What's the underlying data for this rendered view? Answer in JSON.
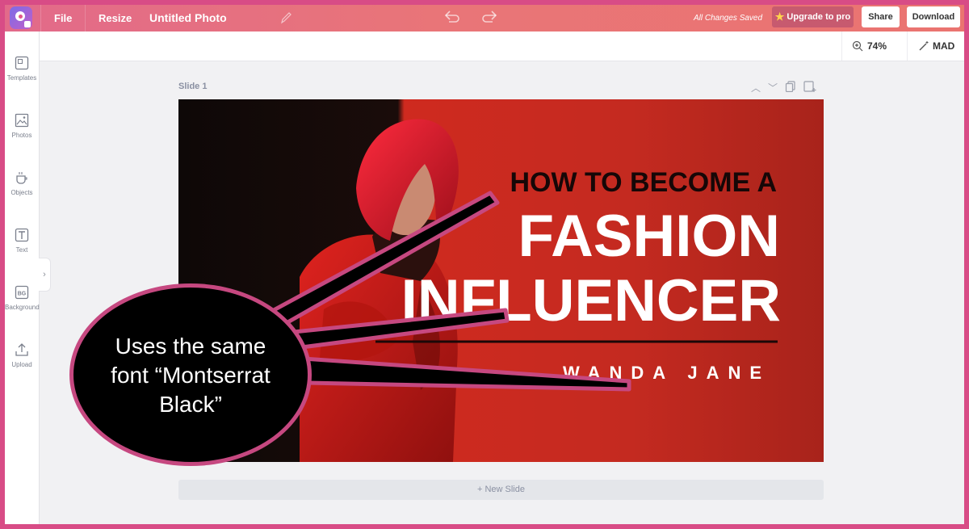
{
  "app": {
    "menu": {
      "file": "File",
      "resize": "Resize"
    },
    "document_title": "Untitled Photo",
    "save_status": "All Changes Saved",
    "buttons": {
      "upgrade": "Upgrade to pro",
      "share": "Share",
      "download": "Download"
    }
  },
  "sidebar": {
    "items": [
      {
        "label": "Templates",
        "icon": "templates-icon"
      },
      {
        "label": "Photos",
        "icon": "photos-icon"
      },
      {
        "label": "Objects",
        "icon": "objects-icon"
      },
      {
        "label": "Text",
        "icon": "text-icon"
      },
      {
        "label": "Background",
        "icon": "background-icon"
      },
      {
        "label": "Upload",
        "icon": "upload-icon"
      }
    ]
  },
  "toolbar": {
    "zoom": "74%",
    "magic": "MAD"
  },
  "slide": {
    "label": "Slide 1",
    "heading_small": "HOW TO BECOME A",
    "heading_line1": "FASHION",
    "heading_line2": "INFLUENCER",
    "author": "WANDA JANE"
  },
  "callout": {
    "line1": "Uses the same",
    "line2": "font “Montserrat",
    "line3": "Black”"
  },
  "new_slide": "+ New Slide",
  "colors": {
    "accent": "#d84c86",
    "slide_red": "#c42a20",
    "callout_border": "#c64880"
  }
}
